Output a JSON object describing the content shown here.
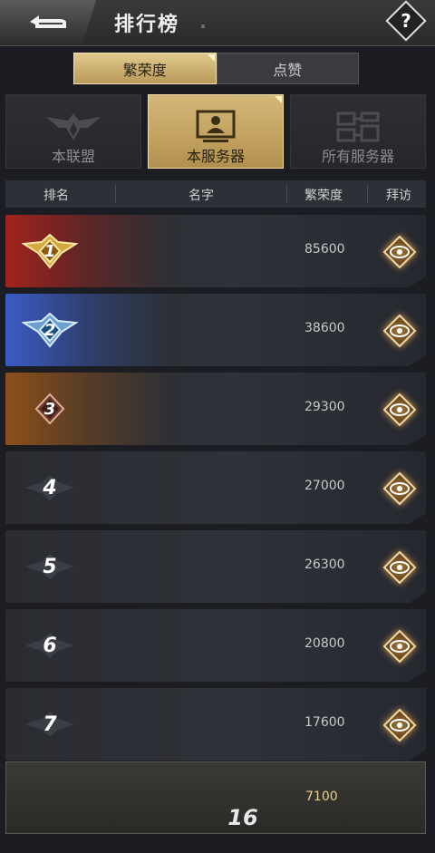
{
  "header": {
    "title": "排行榜",
    "help_label": "?"
  },
  "top_tabs": [
    {
      "label": "繁荣度",
      "active": true
    },
    {
      "label": "点赞",
      "active": false
    }
  ],
  "scope_tabs": [
    {
      "label": "本联盟",
      "icon": "eagle-emblem-icon",
      "active": false
    },
    {
      "label": "本服务器",
      "icon": "server-monitor-icon",
      "active": true
    },
    {
      "label": "所有服务器",
      "icon": "server-network-icon",
      "active": false
    }
  ],
  "columns": {
    "rank": "排名",
    "name": "名字",
    "prosperity": "繁荣度",
    "visit": "拜访"
  },
  "rows": [
    {
      "rank": "1",
      "name": "",
      "score": "85600",
      "tier": "gold"
    },
    {
      "rank": "2",
      "name": "",
      "score": "38600",
      "tier": "blue"
    },
    {
      "rank": "3",
      "name": "",
      "score": "29300",
      "tier": "bronze"
    },
    {
      "rank": "4",
      "name": "",
      "score": "27000",
      "tier": "plain"
    },
    {
      "rank": "5",
      "name": "",
      "score": "26300",
      "tier": "plain"
    },
    {
      "rank": "6",
      "name": "",
      "score": "20800",
      "tier": "plain"
    },
    {
      "rank": "7",
      "name": "",
      "score": "17600",
      "tier": "plain"
    }
  ],
  "my_row": {
    "rank": "16",
    "score": "7100"
  },
  "colors": {
    "gold": "#d9ba72",
    "rank1_glow": "#b3251f",
    "rank2_glow": "#3554b8",
    "rank3_glow": "#9b5a1e"
  }
}
